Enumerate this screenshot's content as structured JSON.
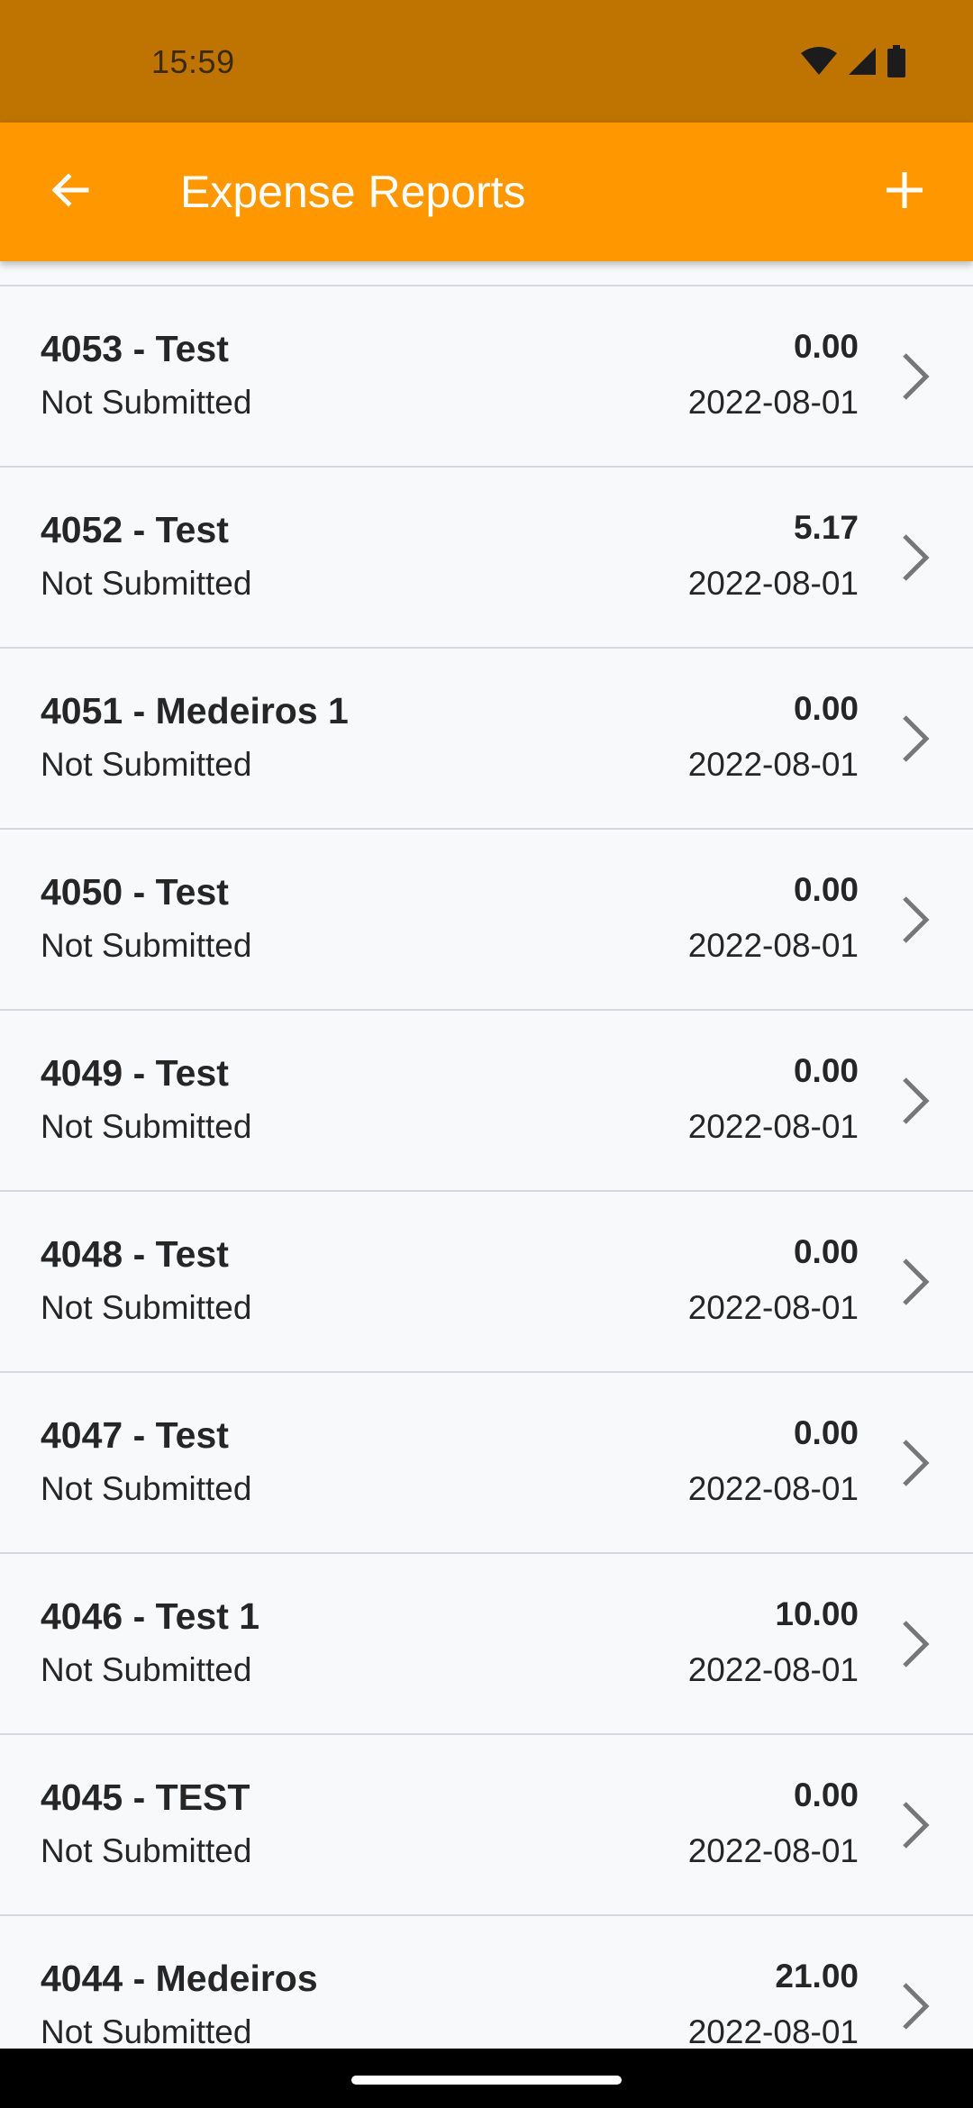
{
  "status_bar": {
    "time": "15:59",
    "icons": [
      "wifi-icon",
      "cellular-signal-icon",
      "battery-icon"
    ]
  },
  "app_bar": {
    "title": "Expense Reports",
    "back_icon": "arrow-left-icon",
    "add_icon": "plus-icon",
    "color": "#ff9800"
  },
  "reports": [
    {
      "title": "4053 - Test",
      "status": "Not Submitted",
      "amount": "0.00",
      "date": "2022-08-01"
    },
    {
      "title": "4052 - Test",
      "status": "Not Submitted",
      "amount": "5.17",
      "date": "2022-08-01"
    },
    {
      "title": "4051 - Medeiros 1",
      "status": "Not Submitted",
      "amount": "0.00",
      "date": "2022-08-01"
    },
    {
      "title": "4050 - Test",
      "status": "Not Submitted",
      "amount": "0.00",
      "date": "2022-08-01"
    },
    {
      "title": "4049 - Test",
      "status": "Not Submitted",
      "amount": "0.00",
      "date": "2022-08-01"
    },
    {
      "title": "4048 - Test",
      "status": "Not Submitted",
      "amount": "0.00",
      "date": "2022-08-01"
    },
    {
      "title": "4047 - Test",
      "status": "Not Submitted",
      "amount": "0.00",
      "date": "2022-08-01"
    },
    {
      "title": "4046 - Test 1",
      "status": "Not Submitted",
      "amount": "10.00",
      "date": "2022-08-01"
    },
    {
      "title": "4045 - TEST",
      "status": "Not Submitted",
      "amount": "0.00",
      "date": "2022-08-01"
    },
    {
      "title": "4044 - Medeiros",
      "status": "Not Submitted",
      "amount": "21.00",
      "date": "2022-08-01"
    }
  ]
}
